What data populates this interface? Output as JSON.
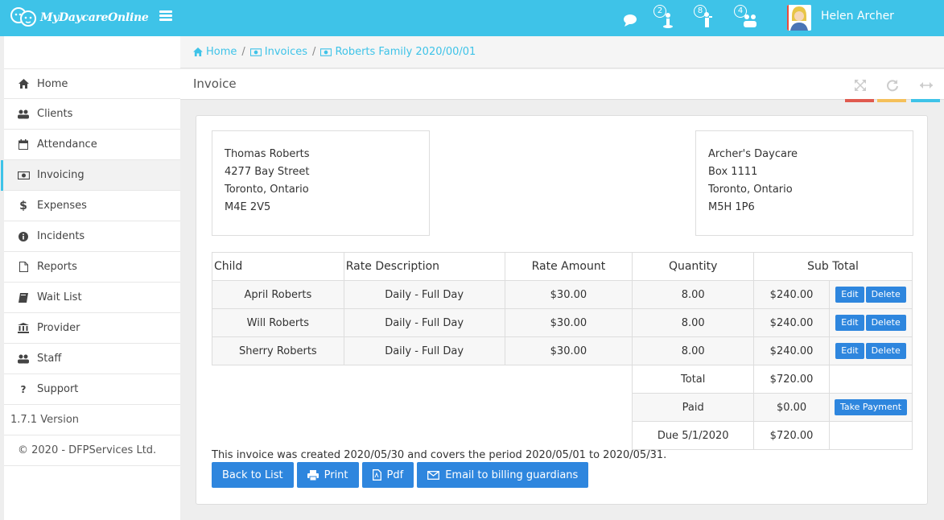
{
  "app": {
    "logo_text": "MyDaycareOnline",
    "accent": "#3ec3e8",
    "button_color": "#2e86de"
  },
  "topbar": {
    "notifications": [
      {
        "icon": "chat-icon",
        "badge": ""
      },
      {
        "icon": "drop-off-icon",
        "badge": "2"
      },
      {
        "icon": "pick-up-icon",
        "badge": "8"
      },
      {
        "icon": "children-icon",
        "badge": "4"
      }
    ],
    "user_name": "Helen Archer"
  },
  "sidebar": {
    "items": [
      {
        "label": "Home",
        "icon": "home-icon"
      },
      {
        "label": "Clients",
        "icon": "users-icon"
      },
      {
        "label": "Attendance",
        "icon": "calendar-icon"
      },
      {
        "label": "Invoicing",
        "icon": "money-icon",
        "active": true
      },
      {
        "label": "Expenses",
        "icon": "dollar-icon"
      },
      {
        "label": "Incidents",
        "icon": "info-icon"
      },
      {
        "label": "Reports",
        "icon": "file-icon"
      },
      {
        "label": "Wait List",
        "icon": "book-icon"
      },
      {
        "label": "Provider",
        "icon": "bank-icon"
      },
      {
        "label": "Staff",
        "icon": "users-icon"
      },
      {
        "label": "Support",
        "icon": "question-icon"
      }
    ],
    "version": "1.7.1 Version",
    "copyright": "©  2020 - DFPServices Ltd."
  },
  "breadcrumb": [
    "Home",
    "Invoices",
    "Roberts Family 2020/00/01"
  ],
  "page": {
    "title": "Invoice"
  },
  "bill_to": {
    "lines": [
      "Thomas Roberts",
      "4277 Bay Street",
      "Toronto, Ontario",
      "M4E 2V5"
    ]
  },
  "bill_from": {
    "lines": [
      "Archer's Daycare",
      "Box 1111",
      "Toronto, Ontario",
      "M5H 1P6"
    ]
  },
  "table": {
    "headers": [
      "Child",
      "Rate Description",
      "Rate Amount",
      "Quantity",
      "Sub Total"
    ],
    "rows": [
      {
        "child": "April Roberts",
        "desc": "Daily - Full Day",
        "rate": "$30.00",
        "qty": "8.00",
        "sub": "$240.00"
      },
      {
        "child": "Will Roberts",
        "desc": "Daily - Full Day",
        "rate": "$30.00",
        "qty": "8.00",
        "sub": "$240.00"
      },
      {
        "child": "Sherry Roberts",
        "desc": "Daily - Full Day",
        "rate": "$30.00",
        "qty": "8.00",
        "sub": "$240.00"
      }
    ],
    "edit_label": "Edit",
    "delete_label": "Delete",
    "total_label": "Total",
    "total_value": "$720.00",
    "paid_label": "Paid",
    "paid_value": "$0.00",
    "take_payment_label": "Take Payment",
    "due_label": "Due 5/1/2020",
    "due_value": "$720.00"
  },
  "note": "This invoice was created 2020/05/30 and covers the period 2020/05/01 to 2020/05/31.",
  "actions": {
    "back": "Back to List",
    "print": "Print",
    "pdf": "Pdf",
    "email": "Email to billing guardians"
  }
}
